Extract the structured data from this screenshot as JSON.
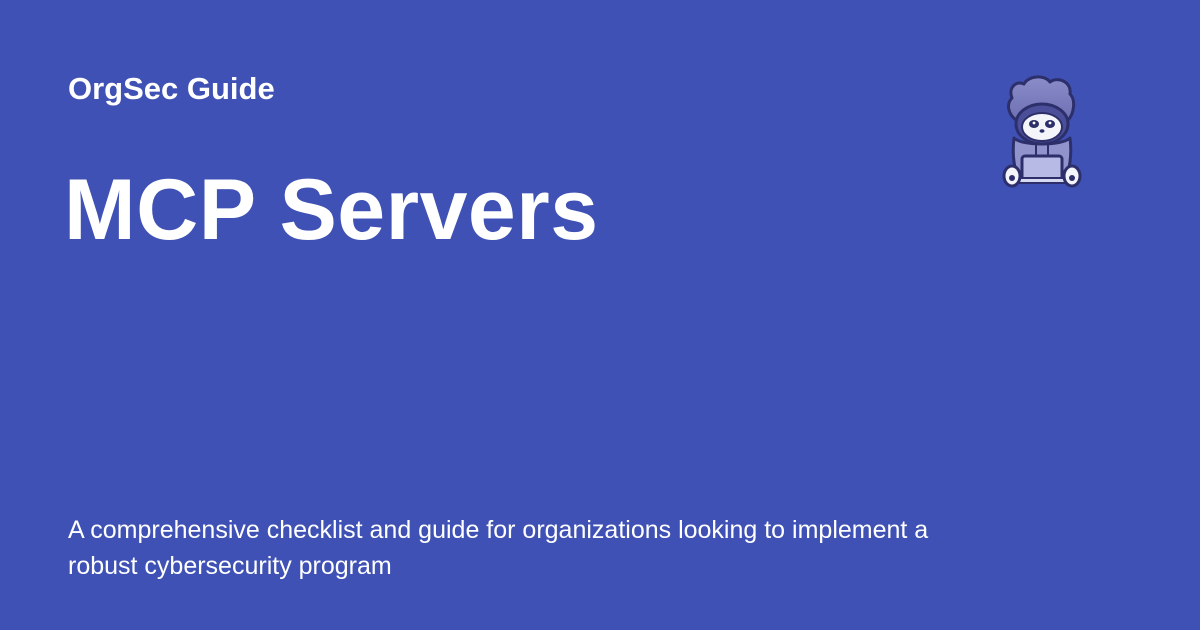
{
  "header": {
    "site_name": "OrgSec Guide"
  },
  "main": {
    "title": "MCP Servers",
    "description": "A comprehensive checklist and guide for organizations looking to implement a robust cybersecurity program"
  },
  "mascot": {
    "icon": "hooded-raccoon-laptop-icon"
  },
  "colors": {
    "background": "#3f51b5",
    "text": "#ffffff"
  }
}
